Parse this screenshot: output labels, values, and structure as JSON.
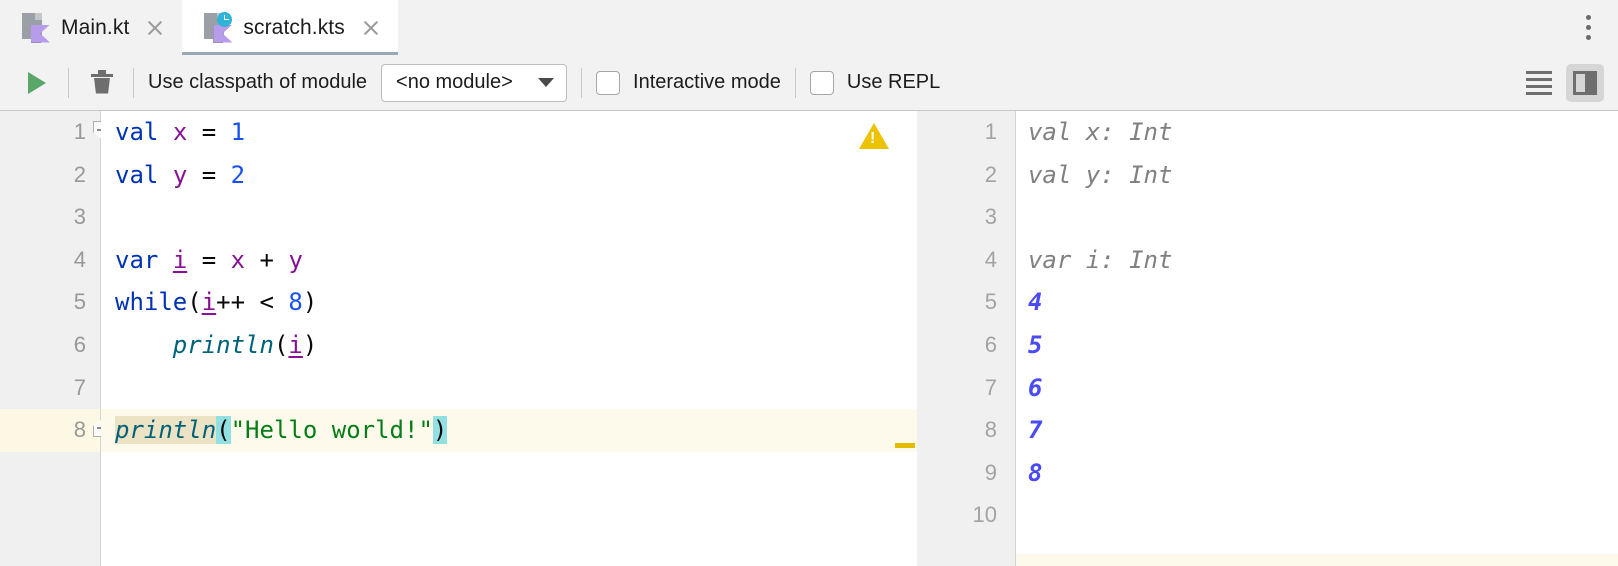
{
  "window": {
    "tabs": [
      {
        "label": "Main.kt",
        "icon": "kotlin-file-icon",
        "active": false,
        "modified": false
      },
      {
        "label": "scratch.kts",
        "icon": "kotlin-scratch-file-icon",
        "active": true,
        "modified": true
      }
    ],
    "overflow_menu_icon": "more-vertical-icon"
  },
  "toolbar": {
    "run_icon": "run-play-icon",
    "clear_icon": "trash-icon",
    "classpath_label": "Use classpath of module",
    "module_value": "<no module>",
    "module_dropdown_icon": "chevron-down-icon",
    "interactive_mode_label": "Interactive mode",
    "interactive_mode_checked": false,
    "use_repl_label": "Use REPL",
    "use_repl_checked": false,
    "lines_icon": "list-lines-icon",
    "split_panel_icon": "split-editor-icon",
    "split_panel_pressed": true
  },
  "editor": {
    "caret_line": 8,
    "warning_icon": "warning-triangle-icon",
    "line_numbers": [
      "1",
      "2",
      "3",
      "4",
      "5",
      "6",
      "7",
      "8"
    ],
    "lines": [
      {
        "n": "1",
        "tokens": [
          {
            "t": "val",
            "c": "kw"
          },
          {
            "t": " ",
            "c": "op"
          },
          {
            "t": "x",
            "c": "id"
          },
          {
            "t": " ",
            "c": "op"
          },
          {
            "t": "=",
            "c": "op"
          },
          {
            "t": " ",
            "c": "op"
          },
          {
            "t": "1",
            "c": "num"
          }
        ]
      },
      {
        "n": "2",
        "tokens": [
          {
            "t": "val",
            "c": "kw"
          },
          {
            "t": " ",
            "c": "op"
          },
          {
            "t": "y",
            "c": "id"
          },
          {
            "t": " ",
            "c": "op"
          },
          {
            "t": "=",
            "c": "op"
          },
          {
            "t": " ",
            "c": "op"
          },
          {
            "t": "2",
            "c": "num"
          }
        ]
      },
      {
        "n": "3",
        "tokens": []
      },
      {
        "n": "4",
        "tokens": [
          {
            "t": "var",
            "c": "kw"
          },
          {
            "t": " ",
            "c": "op"
          },
          {
            "t": "i",
            "c": "id underline"
          },
          {
            "t": " ",
            "c": "op"
          },
          {
            "t": "=",
            "c": "op"
          },
          {
            "t": " ",
            "c": "op"
          },
          {
            "t": "x",
            "c": "id"
          },
          {
            "t": " ",
            "c": "op"
          },
          {
            "t": "+",
            "c": "op"
          },
          {
            "t": " ",
            "c": "op"
          },
          {
            "t": "y",
            "c": "id"
          }
        ]
      },
      {
        "n": "5",
        "tokens": [
          {
            "t": "while",
            "c": "kw"
          },
          {
            "t": "(",
            "c": "op"
          },
          {
            "t": "i",
            "c": "id underline"
          },
          {
            "t": "++",
            "c": "op"
          },
          {
            "t": " ",
            "c": "op"
          },
          {
            "t": "<",
            "c": "op"
          },
          {
            "t": " ",
            "c": "op"
          },
          {
            "t": "8",
            "c": "num"
          },
          {
            "t": ")",
            "c": "op"
          }
        ]
      },
      {
        "n": "6",
        "tokens": [
          {
            "t": "    ",
            "c": "op"
          },
          {
            "t": "println",
            "c": "fn"
          },
          {
            "t": "(",
            "c": "op"
          },
          {
            "t": "i",
            "c": "id underline"
          },
          {
            "t": ")",
            "c": "op"
          }
        ]
      },
      {
        "n": "7",
        "tokens": []
      },
      {
        "n": "8",
        "tokens": [
          {
            "t": "println",
            "c": "fn hl-ident"
          },
          {
            "t": "(",
            "c": "op hl-brace"
          },
          {
            "t": "\"Hello world!\"",
            "c": "str"
          },
          {
            "t": ")",
            "c": "op hl-brace"
          }
        ]
      }
    ]
  },
  "output": {
    "line_numbers": [
      "1",
      "2",
      "3",
      "4",
      "5",
      "6",
      "7",
      "8",
      "9",
      "10"
    ],
    "rows": [
      {
        "n": "1",
        "text": "val x: Int",
        "kind": "out-decl"
      },
      {
        "n": "2",
        "text": "val y: Int",
        "kind": "out-decl"
      },
      {
        "n": "3",
        "text": "",
        "kind": "out-decl"
      },
      {
        "n": "4",
        "text": "var i: Int",
        "kind": "out-decl"
      },
      {
        "n": "5",
        "text": "4",
        "kind": "out-value"
      },
      {
        "n": "6",
        "text": "5",
        "kind": "out-value"
      },
      {
        "n": "7",
        "text": "6",
        "kind": "out-value"
      },
      {
        "n": "8",
        "text": "7",
        "kind": "out-value"
      },
      {
        "n": "9",
        "text": "8",
        "kind": "out-value"
      },
      {
        "n": "10",
        "text": "",
        "kind": "out-decl"
      }
    ]
  },
  "colors": {
    "keyword": "#0033b3",
    "identifier": "#871094",
    "number": "#1750eb",
    "string": "#067d17",
    "function": "#00627a",
    "output_value": "#4b4bf5",
    "output_decl": "#808080",
    "caret_line_bg": "#fdfaec",
    "warning": "#edc200",
    "run_green": "#59a869",
    "tab_underline": "#9aa7b5"
  }
}
